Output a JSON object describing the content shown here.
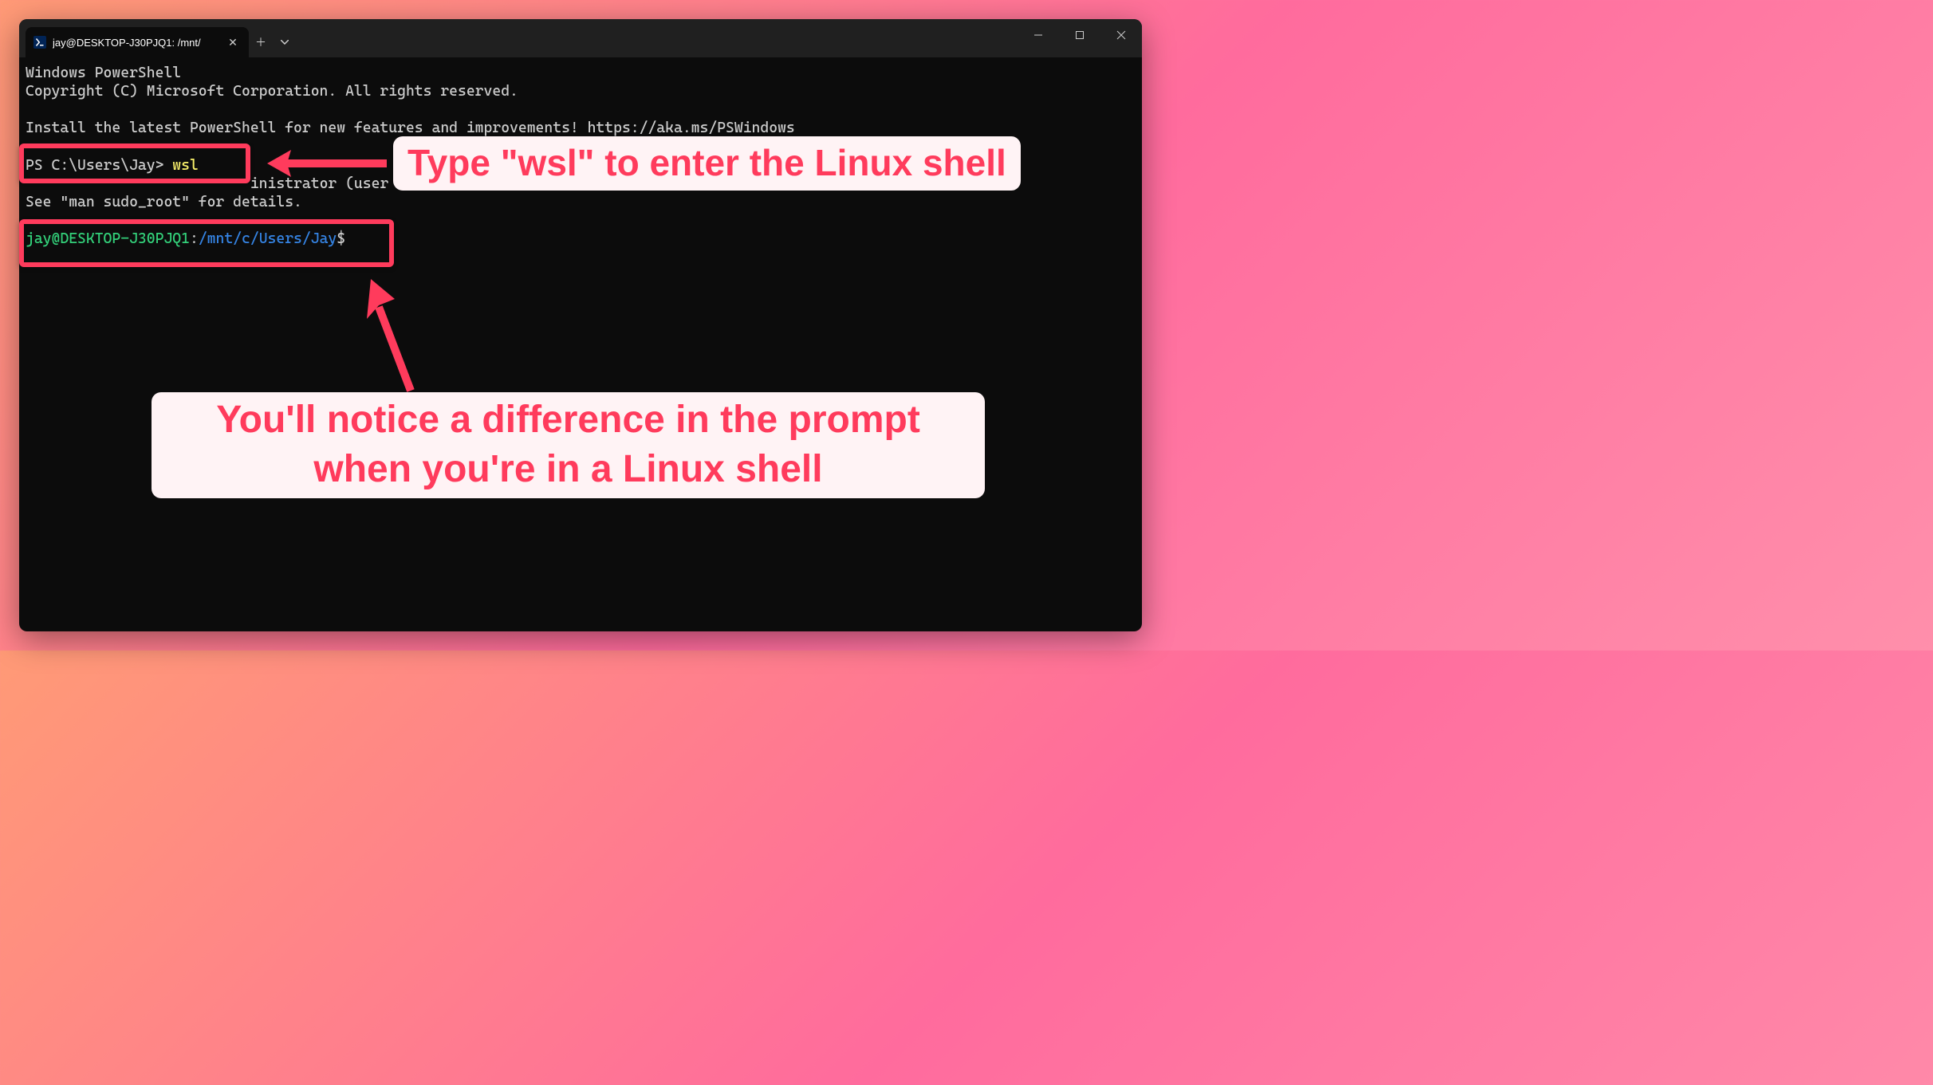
{
  "titlebar": {
    "tab_title": "jay@DESKTOP-J30PJQ1: /mnt/",
    "tab_icon_label": ">_"
  },
  "terminal": {
    "line1": "Windows PowerShell",
    "line2": "Copyright (C) Microsoft Corporation. All rights reserved.",
    "line4": "Install the latest PowerShell for new features and improvements! https://aka.ms/PSWindows",
    "ps_prompt": "PS C:\\Users\\Jay> ",
    "ps_command": "wsl",
    "line_admin_fragment": "inistrator (user \"",
    "line_sudo": "See \"man sudo_root\" for details.",
    "linux_user": "jay@DESKTOP-J30PJQ1",
    "linux_colon": ":",
    "linux_path": "/mnt/c/Users/Jay",
    "linux_dollar": "$"
  },
  "callouts": {
    "top": "Type \"wsl\" to enter the Linux shell",
    "bottom": "You'll notice a difference in the prompt when you're in a Linux shell"
  }
}
